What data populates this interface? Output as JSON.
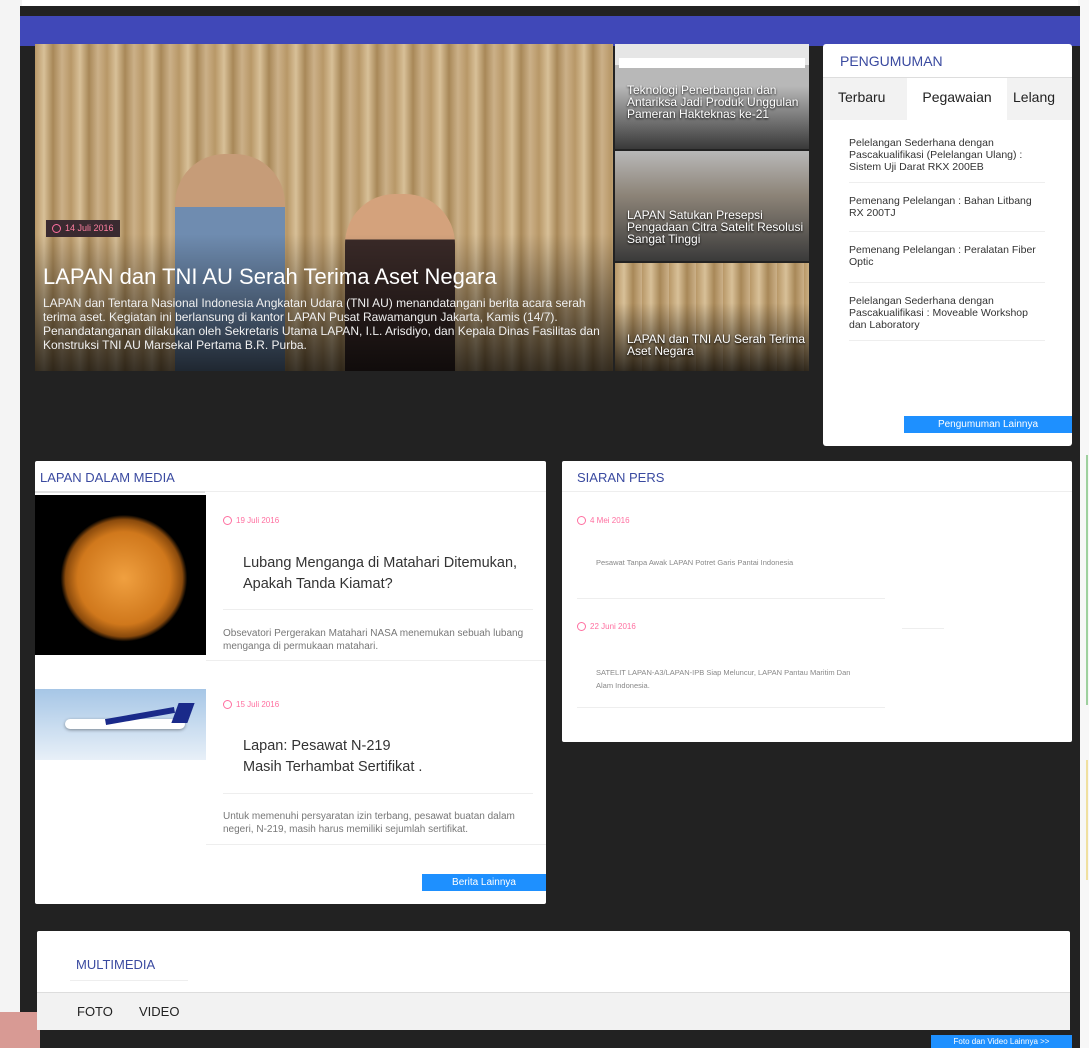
{
  "colors": {
    "accent_blue": "#4048b8",
    "button_blue": "#1e90ff",
    "date_pink": "#ff6fa0",
    "title_blue": "#3a4aa0",
    "dark_bg": "#222222"
  },
  "hero": {
    "date": "14 Juli 2016",
    "title": "LAPAN dan TNI AU Serah Terima Aset Negara",
    "description": "LAPAN dan Tentara Nasional Indonesia Angkatan Udara (TNI AU) menandatangani berita acara serah terima aset. Kegiatan ini berlansung di kantor LAPAN Pusat Rawamangun Jakarta, Kamis (14/7). Penandatanganan dilakukan oleh Sekretaris Utama LAPAN, I.L. Arisdiyo, dan Kepala Dinas Fasilitas dan Konstruksi TNI AU Marsekal Pertama B.R. Purba."
  },
  "side_news": [
    {
      "label": "Teknologi Penerbangan dan Antariksa Jadi Produk Unggulan Pameran Hakteknas ke-21"
    },
    {
      "label": "LAPAN Satukan Presepsi Pengadaan Citra Satelit Resolusi Sangat Tinggi"
    },
    {
      "label": "LAPAN dan TNI AU Serah Terima Aset Negara"
    }
  ],
  "announcements": {
    "title": "PENGUMUMAN",
    "tabs": [
      "Terbaru",
      "Pegawaian",
      "Lelang"
    ],
    "items": [
      "Pelelangan Sederhana dengan Pascakualifikasi (Pelelangan Ulang) : Sistem Uji Darat RKX 200EB",
      "Pemenang Pelelangan : Bahan Litbang RX 200TJ",
      "Pemenang Pelelangan : Peralatan Fiber Optic",
      "Pelelangan Sederhana dengan Pascakualifikasi : Moveable Workshop dan Laboratory"
    ],
    "more_label": "Pengumuman Lainnya"
  },
  "media": {
    "title": "LAPAN DALAM MEDIA",
    "items": [
      {
        "date": "19 Juli 2016",
        "title": "Lubang Menganga di Matahari Ditemukan, Apakah Tanda Kiamat?",
        "description": "Obsevatori Pergerakan Matahari NASA menemukan sebuah lubang menganga di permukaan matahari."
      },
      {
        "date": "15 Juli 2016",
        "title": "Lapan: Pesawat N-219 Masih Terhambat Sertifikat .",
        "description": "Untuk memenuhi persyaratan izin terbang, pesawat buatan dalam negeri, N-219, masih harus memiliki sejumlah sertifikat."
      }
    ],
    "more_label": "Berita Lainnya"
  },
  "press": {
    "title": "SIARAN PERS",
    "items": [
      {
        "date": "4 Mei 2016",
        "title": "Pesawat Tanpa Awak LAPAN Potret Garis Pantai Indonesia"
      },
      {
        "date": "22 Juni 2016",
        "title": "SATELIT LAPAN-A3/LAPAN-IPB Siap Meluncur, LAPAN Pantau Maritim Dan Alam Indonesia."
      }
    ]
  },
  "multimedia": {
    "title": "MULTIMEDIA",
    "tabs": [
      "FOTO",
      "VIDEO"
    ],
    "more_label": "Foto dan Video Lainnya >>"
  }
}
